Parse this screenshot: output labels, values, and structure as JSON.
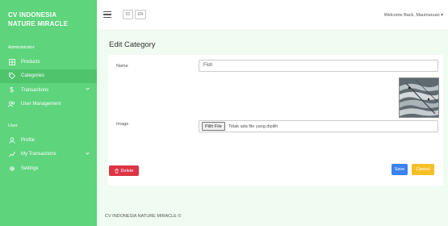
{
  "sidebar": {
    "brand_line1": "CV INDONESIA",
    "brand_line2": "NATURE MIRACLE",
    "admin_heading": "Administrator",
    "admin_items": [
      {
        "label": "Products",
        "icon": "grid-icon"
      },
      {
        "label": "Categories",
        "icon": "tags-icon",
        "active": true
      },
      {
        "label": "Transactions",
        "icon": "dollar-icon"
      },
      {
        "label": "User Management",
        "icon": "users-icon"
      }
    ],
    "user_heading": "User",
    "user_items": [
      {
        "label": "Profile",
        "icon": "user-icon"
      },
      {
        "label": "My Transactions",
        "icon": "chart-icon"
      },
      {
        "label": "Settings",
        "icon": "gear-icon"
      }
    ]
  },
  "topbar": {
    "lang_id": "ID",
    "lang_en": "EN",
    "welcome": "Welcome Back, Maumaruan"
  },
  "page": {
    "title": "Edit Category"
  },
  "form": {
    "name_label": "Name",
    "name_value": "Fish",
    "image_label": "Image",
    "file_button": "Pilih File",
    "file_status": "Tidak ada file yang dipilih",
    "save_label": "Save",
    "cancel_label": "Cancel"
  },
  "delete_label": "Delete",
  "footer": "CV INDONESIA NATURE MIRACLE ©",
  "colors": {
    "sidebar": "#5ed47c",
    "content_bg": "#f0fbf2",
    "save": "#3b82f0",
    "cancel": "#f5c027",
    "delete": "#dc3545"
  }
}
